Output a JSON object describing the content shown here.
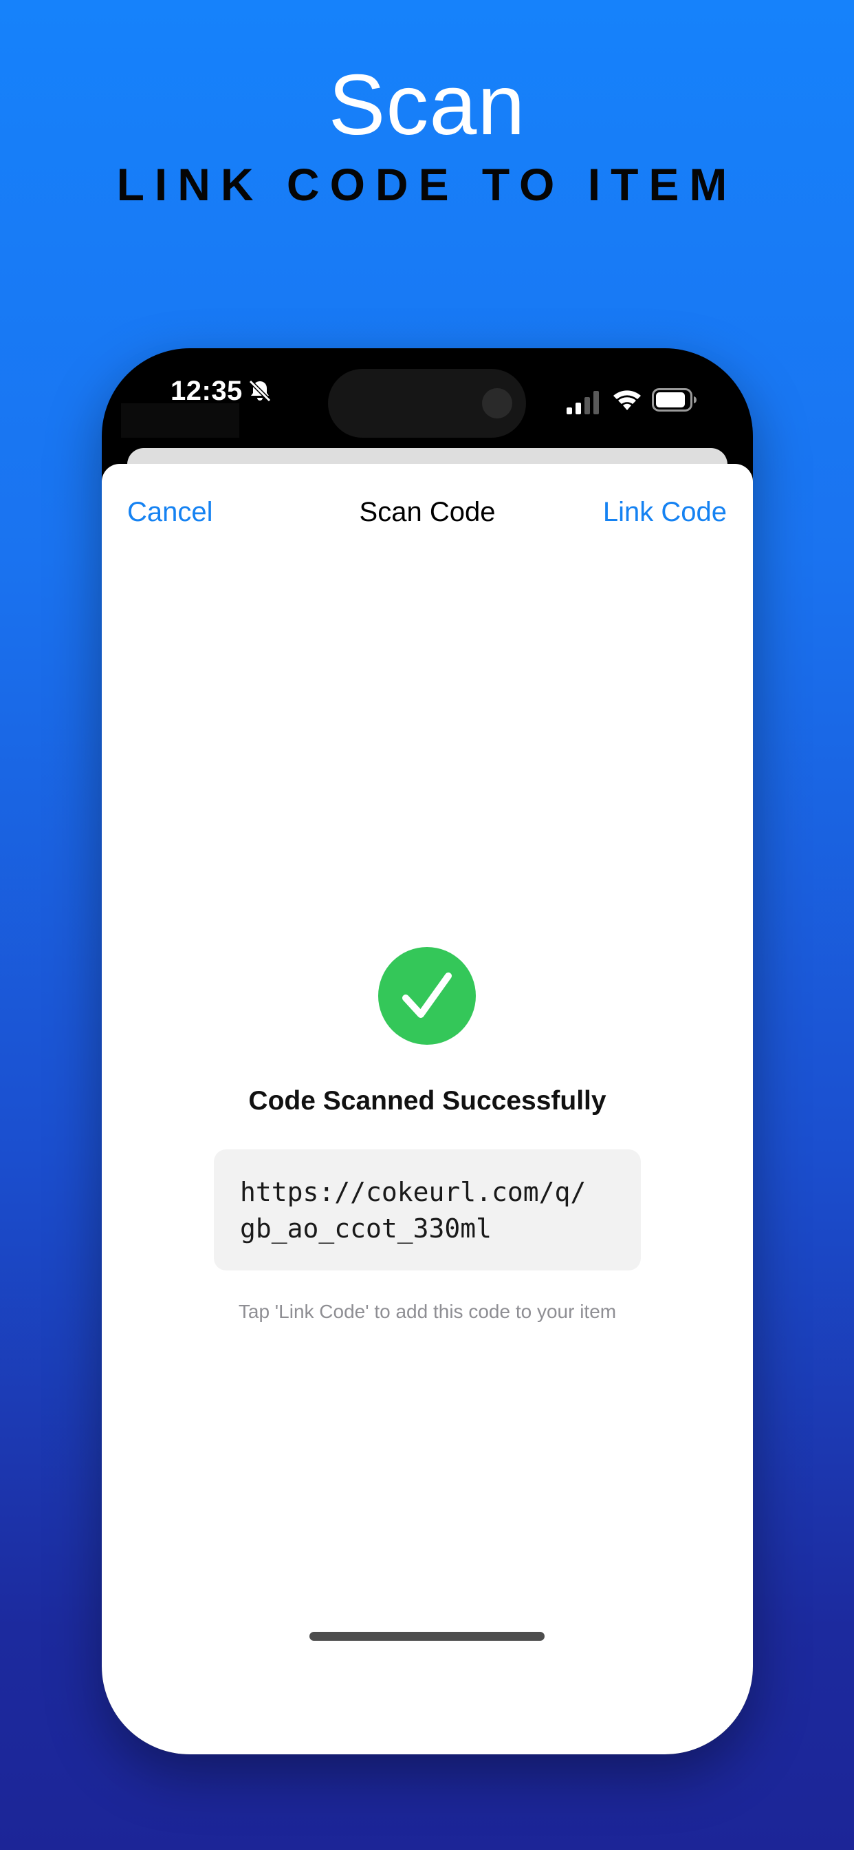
{
  "promo": {
    "title": "Scan",
    "subtitle": "LINK CODE TO ITEM"
  },
  "status_bar": {
    "time": "12:35",
    "icons": [
      "bell-slash-icon",
      "cellular-signal-icon",
      "wifi-icon",
      "battery-icon"
    ]
  },
  "nav": {
    "cancel_label": "Cancel",
    "title": "Scan Code",
    "link_label": "Link Code"
  },
  "result": {
    "icon": "checkmark-circle-icon",
    "title": "Code Scanned Successfully",
    "code_value": "https://cokeurl.com/q/\ngb_ao_ccot_330ml",
    "hint": "Tap 'Link Code' to add this code to your item"
  },
  "colors": {
    "accent": "#1582f2",
    "success": "#34c759",
    "background_top": "#1682fb",
    "background_bottom": "#1c2597"
  }
}
